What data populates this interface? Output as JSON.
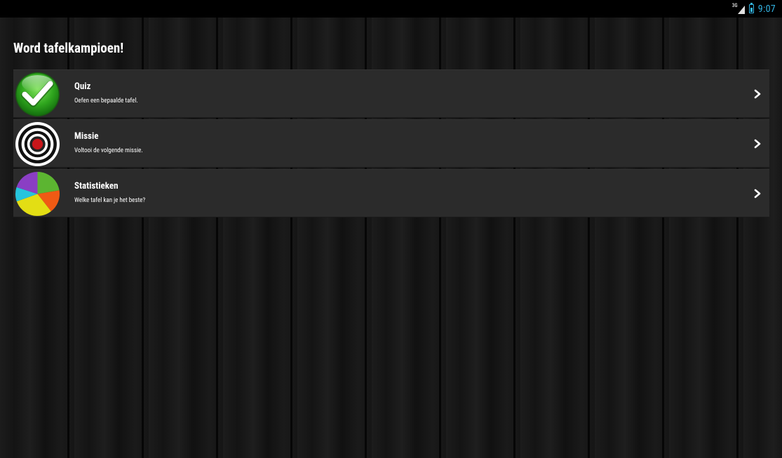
{
  "statusbar": {
    "network_type": "3G",
    "time": "9:07"
  },
  "title": "Word tafelkampioen!",
  "menu": {
    "items": [
      {
        "title": "Quiz",
        "subtitle": "Oefen een bepaalde tafel.",
        "icon": "green-checkmark-icon"
      },
      {
        "title": "Missie",
        "subtitle": "Voltooi de volgende missie.",
        "icon": "target-icon"
      },
      {
        "title": "Statistieken",
        "subtitle": "Welke tafel kan je het beste?",
        "icon": "pie-chart-icon"
      }
    ]
  },
  "colors": {
    "accent": "#33b5e5",
    "item_background": "#2b2b2b"
  }
}
